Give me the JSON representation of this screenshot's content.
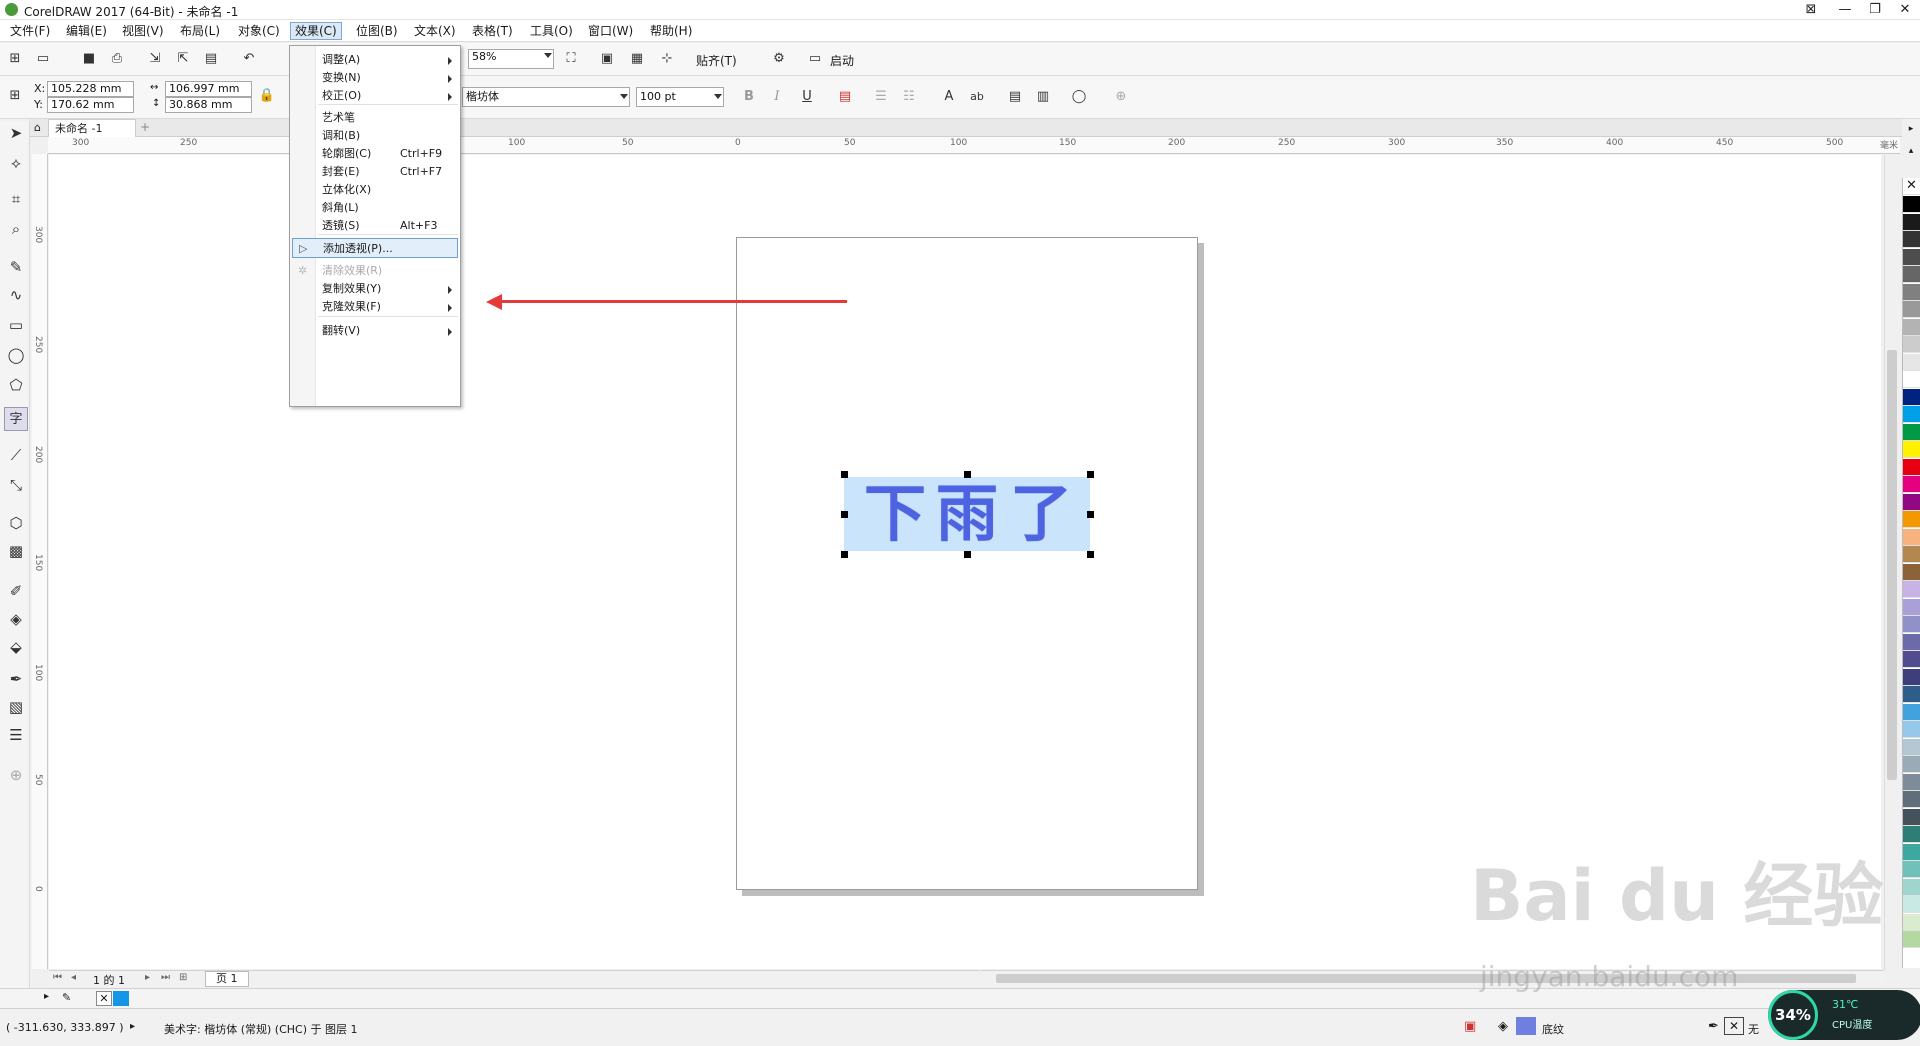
{
  "window": {
    "title": "CorelDRAW 2017 (64-Bit) - 未命名 -1",
    "controls": [
      "⊠",
      "—",
      "❐",
      "✕"
    ]
  },
  "menubar": [
    {
      "label": "文件(F)"
    },
    {
      "label": "编辑(E)"
    },
    {
      "label": "视图(V)"
    },
    {
      "label": "布局(L)"
    },
    {
      "label": "对象(C)"
    },
    {
      "label": "效果(C)"
    },
    {
      "label": "位图(B)"
    },
    {
      "label": "文本(X)"
    },
    {
      "label": "表格(T)"
    },
    {
      "label": "工具(O)"
    },
    {
      "label": "窗口(W)"
    },
    {
      "label": "帮助(H)"
    }
  ],
  "standard_toolbar": {
    "zoom": "58%",
    "snap_label": "贴齐(T)",
    "launch_label": "启动"
  },
  "property_bar": {
    "x": "105.228 mm",
    "y": "170.62 mm",
    "w": "106.997 mm",
    "h": "30.868 mm",
    "x_label": "X:",
    "y_label": "Y:",
    "font": "楷坊体",
    "size": "100 pt",
    "bold": "B",
    "italic": "I",
    "underline": "U"
  },
  "document_tab": "未命名 -1",
  "ruler_h_labels": [
    "300",
    "250",
    "100",
    "50",
    "0",
    "50",
    "100",
    "150",
    "200",
    "250",
    "300",
    "350",
    "400",
    "450",
    "500"
  ],
  "ruler_h_unit": "毫米",
  "ruler_v_labels": [
    "300",
    "250",
    "200",
    "150",
    "100",
    "50",
    "0"
  ],
  "effects_menu": [
    {
      "label": "调整(A)",
      "shortcut": "",
      "sub": true
    },
    {
      "label": "变换(N)",
      "shortcut": "",
      "sub": true
    },
    {
      "label": "校正(O)",
      "shortcut": "",
      "sub": true
    },
    {
      "label": "艺术笔",
      "shortcut": "",
      "sub": false
    },
    {
      "label": "调和(B)",
      "shortcut": "",
      "sub": false
    },
    {
      "label": "轮廓图(C)",
      "shortcut": "Ctrl+F9",
      "sub": false
    },
    {
      "label": "封套(E)",
      "shortcut": "Ctrl+F7",
      "sub": false
    },
    {
      "label": "立体化(X)",
      "shortcut": "",
      "sub": false
    },
    {
      "label": "斜角(L)",
      "shortcut": "",
      "sub": false
    },
    {
      "label": "透镜(S)",
      "shortcut": "Alt+F3",
      "sub": false
    },
    {
      "label": "添加透视(P)...",
      "shortcut": "",
      "sub": false
    },
    {
      "label": "清除效果(R)",
      "shortcut": "",
      "sub": false
    },
    {
      "label": "复制效果(Y)",
      "shortcut": "",
      "sub": true
    },
    {
      "label": "克隆效果(F)",
      "shortcut": "",
      "sub": true
    },
    {
      "label": "翻转(V)",
      "shortcut": "",
      "sub": true
    }
  ],
  "artwork_text": [
    "下",
    "雨",
    "了"
  ],
  "page_nav": {
    "page_of": "1 的 1",
    "page_tab": "页 1"
  },
  "status": {
    "coords": "( -311.630, 333.897 )",
    "object_info": "美术字: 楷坊体 (常规) (CHC) 于 图层 1",
    "fill_label": "底纹",
    "outline_label": "无"
  },
  "cpu_widget": {
    "percent": "34%",
    "temp": "31℃",
    "label": "CPU温度"
  },
  "watermark": {
    "main": "Bai du 经验",
    "url": "jingyan.baidu.com"
  },
  "colors": {
    "accent_arrow": "#e53a3a",
    "selection_fill": "#c9e4fb",
    "text_fill": "#4d63e0"
  },
  "palette_colors": [
    "#000000",
    "#1a1a1a",
    "#333333",
    "#4d4d4d",
    "#666666",
    "#808080",
    "#999999",
    "#b3b3b3",
    "#cccccc",
    "#e6e6e6",
    "#ffffff",
    "#00237f",
    "#00a0e9",
    "#009944",
    "#fff100",
    "#e60012",
    "#e4007f",
    "#920783",
    "#f39800",
    "#f6b37f",
    "#b28850",
    "#8c6239",
    "#c7b3e5",
    "#a9a0d8",
    "#9190c8",
    "#6c6aa9",
    "#504c8f",
    "#3d3f7a",
    "#2f5d8a",
    "#41a2dd",
    "#96c8ec",
    "#b6c7d4",
    "#9aaab7",
    "#7d8c98",
    "#606e79",
    "#46525b",
    "#2f7e76",
    "#3ea89f",
    "#6fc1b9",
    "#9ed6ce",
    "#c9e9e4",
    "#d9ecd0",
    "#b3d9a0"
  ]
}
